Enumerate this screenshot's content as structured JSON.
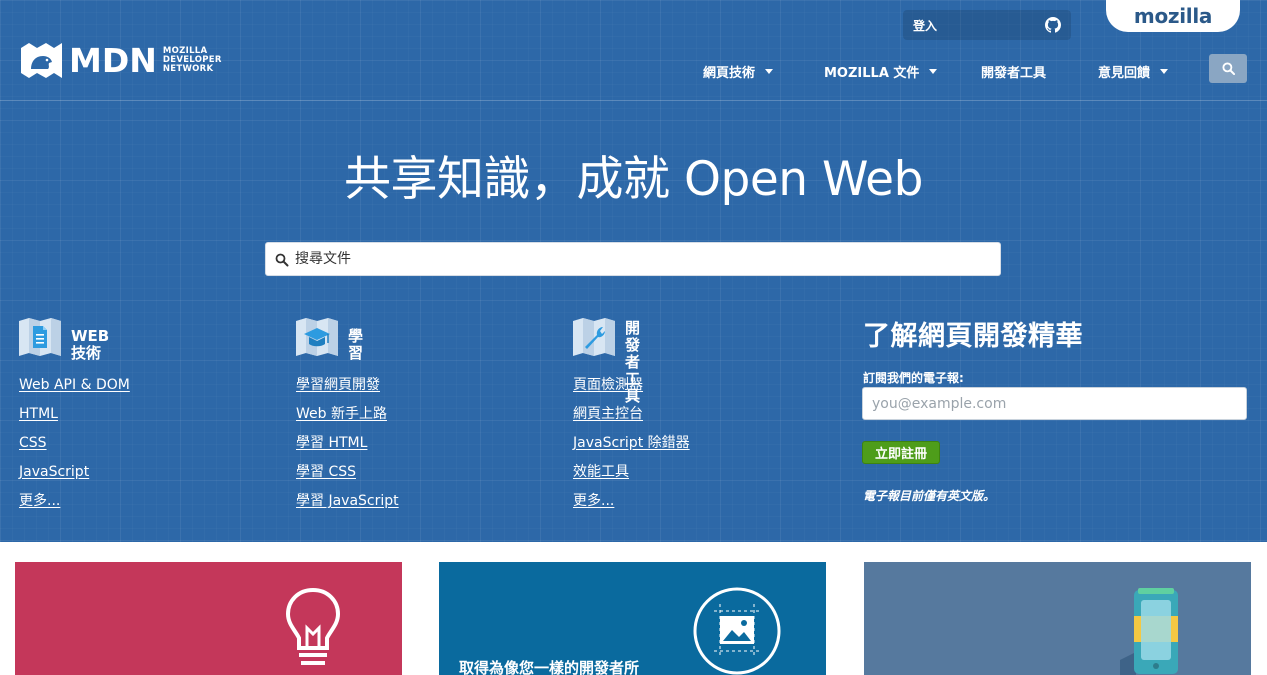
{
  "header": {
    "login_label": "登入",
    "mozilla_tab_label": "mozilla",
    "logo": {
      "mark": "MDN",
      "sub_lines": [
        "MOZILLA",
        "DEVELOPER",
        "NETWORK"
      ]
    },
    "nav": [
      {
        "label": "網頁技術",
        "has_dropdown": true
      },
      {
        "label": "MOZILLA 文件",
        "has_dropdown": true
      },
      {
        "label": "開發者工具",
        "has_dropdown": false
      },
      {
        "label": "意見回饋",
        "has_dropdown": true
      }
    ],
    "search_icon": "search-icon"
  },
  "hero": {
    "headline": "共享知識，成就 Open Web",
    "search_placeholder": "搜尋文件"
  },
  "columns": [
    {
      "icon": "document-icon",
      "title": "WEB 技術",
      "links": [
        "Web API & DOM",
        "HTML",
        "CSS",
        "JavaScript",
        "更多..."
      ]
    },
    {
      "icon": "graduation-cap-icon",
      "title": "學習",
      "links": [
        "學習網頁開發",
        "Web 新手上路",
        "學習 HTML",
        "學習 CSS",
        "學習 JavaScript"
      ]
    },
    {
      "icon": "wrench-icon",
      "title_lines": [
        "開發者",
        "工具"
      ],
      "links": [
        "頁面檢測器",
        "網頁主控台",
        "JavaScript 除錯器",
        "效能工具",
        "更多..."
      ]
    }
  ],
  "newsletter": {
    "title": "了解網頁開發精華",
    "label": "訂閱我們的電子報:",
    "placeholder": "you@example.com",
    "submit_label": "立即註冊",
    "note": "電子報目前僅有英文版。"
  },
  "cards": [
    {
      "color": "#c4375a",
      "icon": "lightbulb-icon",
      "text": ""
    },
    {
      "color": "#0a6a9e",
      "icon": "image-frame-icon",
      "text": "取得為像您一樣的開發者所"
    },
    {
      "color": "#56799e",
      "icon": "mobile-device-icon",
      "text": ""
    }
  ],
  "colors": {
    "hero_bg": "#2d68a8",
    "accent_green": "#4e9d1a",
    "mozilla_text": "#2b5989"
  }
}
